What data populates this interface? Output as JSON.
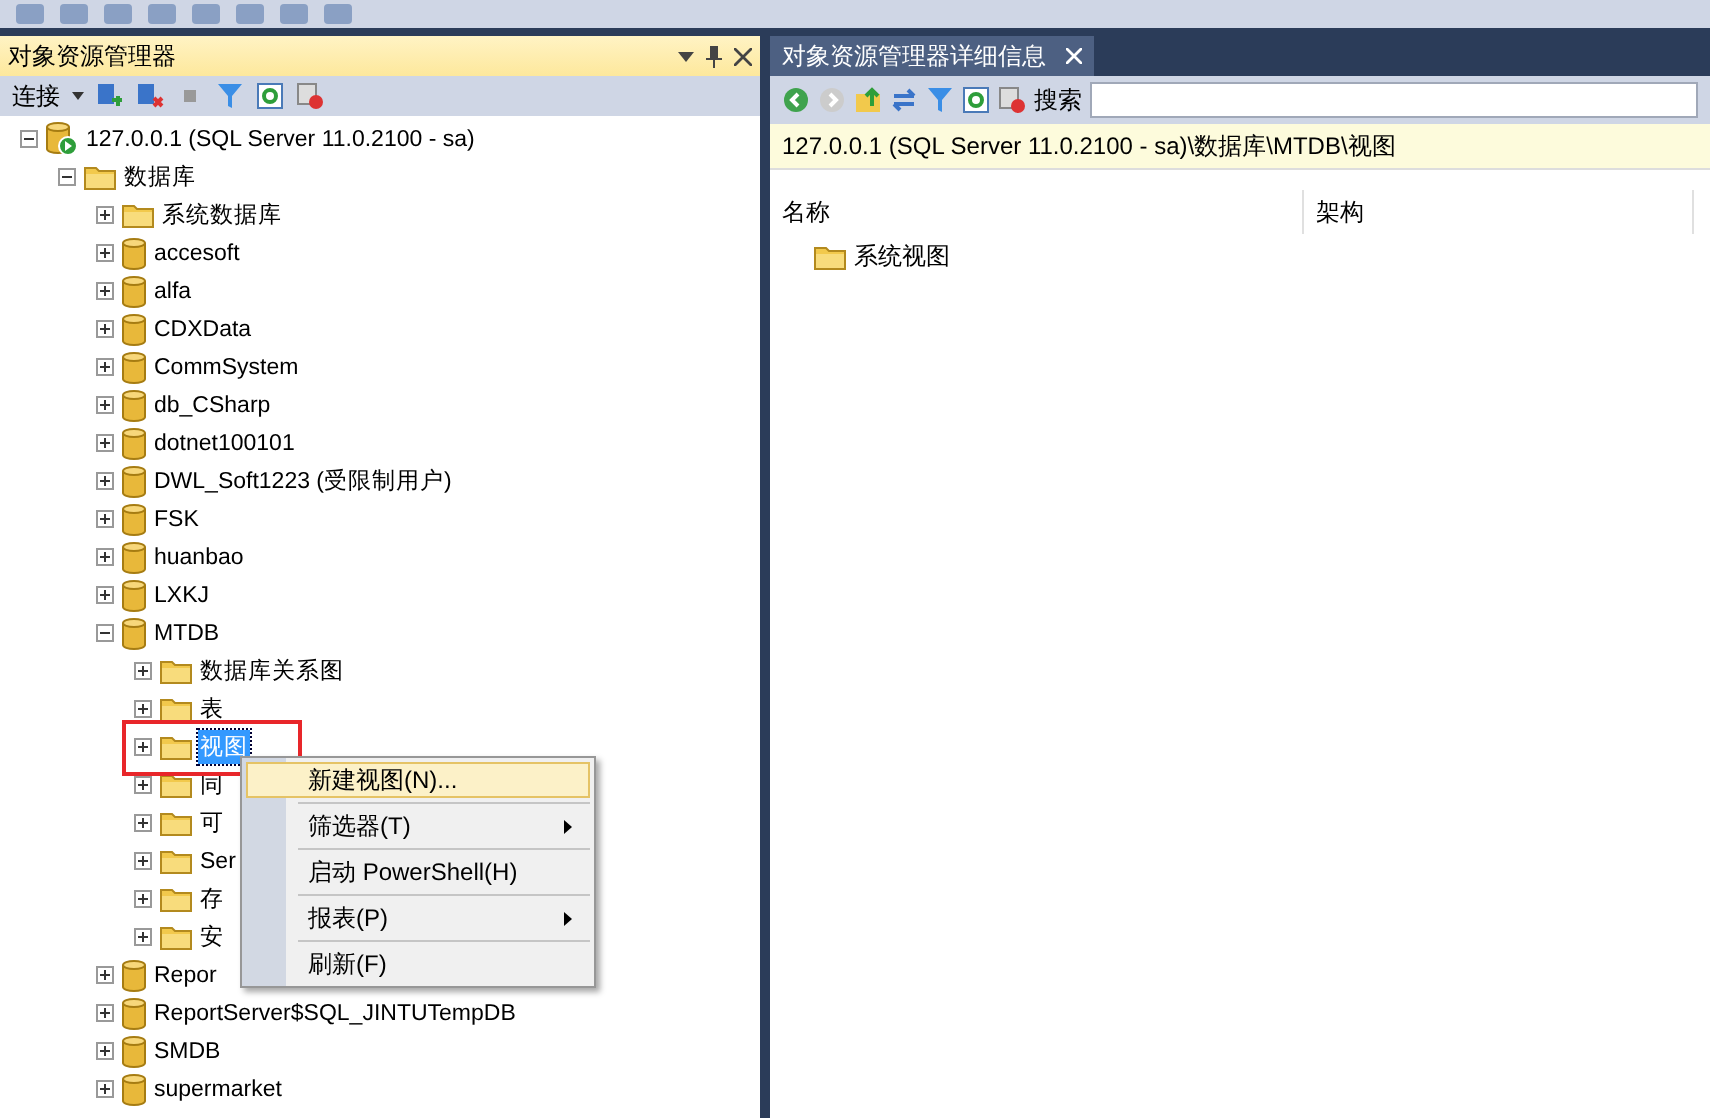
{
  "explorer": {
    "title": "对象资源管理器",
    "toolbar": {
      "connect": "连接"
    },
    "tree": [
      {
        "label": "127.0.0.1 (SQL Server 11.0.2100 - sa)",
        "kind": "server",
        "expanded": true,
        "selected": false,
        "children": [
          {
            "label": "数据库",
            "kind": "folder",
            "expanded": true,
            "selected": false,
            "children": [
              {
                "label": "系统数据库",
                "kind": "folder",
                "expanded": false,
                "selected": false
              },
              {
                "label": "accesoft",
                "kind": "database",
                "expanded": false,
                "selected": false
              },
              {
                "label": "alfa",
                "kind": "database",
                "expanded": false,
                "selected": false
              },
              {
                "label": "CDXData",
                "kind": "database",
                "expanded": false,
                "selected": false
              },
              {
                "label": "CommSystem",
                "kind": "database",
                "expanded": false,
                "selected": false
              },
              {
                "label": "db_CSharp",
                "kind": "database",
                "expanded": false,
                "selected": false
              },
              {
                "label": "dotnet100101",
                "kind": "database",
                "expanded": false,
                "selected": false
              },
              {
                "label": "DWL_Soft1223 (受限制用户)",
                "kind": "database",
                "expanded": false,
                "selected": false
              },
              {
                "label": "FSK",
                "kind": "database",
                "expanded": false,
                "selected": false
              },
              {
                "label": "huanbao",
                "kind": "database",
                "expanded": false,
                "selected": false
              },
              {
                "label": "LXKJ",
                "kind": "database",
                "expanded": false,
                "selected": false
              },
              {
                "label": "MTDB",
                "kind": "database",
                "expanded": true,
                "selected": false,
                "children": [
                  {
                    "label": "数据库关系图",
                    "kind": "folder",
                    "expanded": false,
                    "selected": false
                  },
                  {
                    "label": "表",
                    "kind": "folder",
                    "expanded": false,
                    "selected": false
                  },
                  {
                    "label": "视图",
                    "kind": "folder",
                    "expanded": false,
                    "selected": true
                  },
                  {
                    "label": "同",
                    "kind": "folder",
                    "expanded": false,
                    "selected": false
                  },
                  {
                    "label": "可",
                    "kind": "folder",
                    "expanded": false,
                    "selected": false
                  },
                  {
                    "label": "Ser",
                    "kind": "folder",
                    "expanded": false,
                    "selected": false
                  },
                  {
                    "label": "存",
                    "kind": "folder",
                    "expanded": false,
                    "selected": false
                  },
                  {
                    "label": "安",
                    "kind": "folder",
                    "expanded": false,
                    "selected": false
                  }
                ]
              },
              {
                "label": "Repor",
                "kind": "database",
                "expanded": false,
                "selected": false
              },
              {
                "label": "ReportServer$SQL_JINTUTempDB",
                "kind": "database",
                "expanded": false,
                "selected": false
              },
              {
                "label": "SMDB",
                "kind": "database",
                "expanded": false,
                "selected": false
              },
              {
                "label": "supermarket",
                "kind": "database",
                "expanded": false,
                "selected": false
              }
            ]
          }
        ]
      }
    ]
  },
  "context_menu": [
    {
      "label": "新建视图(N)...",
      "submenu": false,
      "selected": true
    },
    {
      "label": "筛选器(T)",
      "submenu": true,
      "selected": false
    },
    {
      "label": "启动 PowerShell(H)",
      "submenu": false,
      "selected": false
    },
    {
      "label": "报表(P)",
      "submenu": true,
      "selected": false
    },
    {
      "label": "刷新(F)",
      "submenu": false,
      "selected": false
    }
  ],
  "details": {
    "tab": "对象资源管理器详细信息",
    "search_label": "搜索",
    "path": "127.0.0.1 (SQL Server 11.0.2100 - sa)\\数据库\\MTDB\\视图",
    "columns": [
      "名称",
      "架构"
    ],
    "items": [
      {
        "label": "系统视图"
      }
    ]
  }
}
